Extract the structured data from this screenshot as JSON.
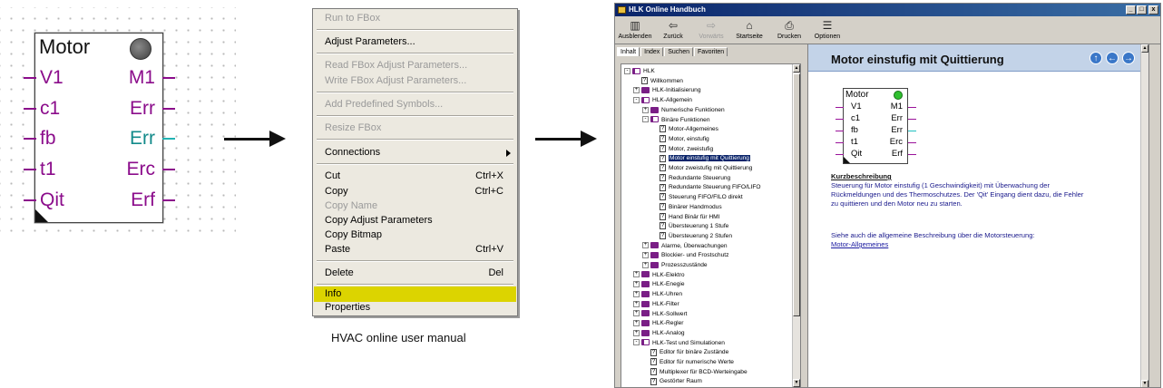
{
  "fbox": {
    "title": "Motor",
    "inputs": [
      "V1",
      "c1",
      "fb",
      "t1",
      "Qit"
    ],
    "outputs": [
      "M1",
      "Err",
      "Err",
      "Erc",
      "Erf"
    ]
  },
  "context_menu": {
    "items": [
      {
        "label": "Run to FBox",
        "enabled": false
      },
      {
        "label": "Adjust Parameters...",
        "enabled": true
      },
      {
        "label": "Read FBox Adjust Parameters...",
        "enabled": false
      },
      {
        "label": "Write FBox Adjust Parameters...",
        "enabled": false
      },
      {
        "label": "Add Predefined Symbols...",
        "enabled": false
      },
      {
        "label": "Resize FBox",
        "enabled": false
      },
      {
        "label": "Connections",
        "enabled": true,
        "submenu": true
      },
      {
        "label": "Cut",
        "shortcut": "Ctrl+X",
        "enabled": true
      },
      {
        "label": "Copy",
        "shortcut": "Ctrl+C",
        "enabled": true
      },
      {
        "label": "Copy Name",
        "enabled": false
      },
      {
        "label": "Copy Adjust Parameters",
        "enabled": true
      },
      {
        "label": "Copy Bitmap",
        "enabled": true
      },
      {
        "label": "Paste",
        "shortcut": "Ctrl+V",
        "enabled": true
      },
      {
        "label": "Delete",
        "shortcut": "Del",
        "enabled": true
      },
      {
        "label": "Info",
        "enabled": true,
        "highlighted": true
      },
      {
        "label": "Properties",
        "enabled": true
      }
    ],
    "highlight_color": "#dcd400"
  },
  "caption": "HVAC online user manual",
  "help_window": {
    "title": "HLK Online Handbuch",
    "window_buttons": [
      "_",
      "□",
      "x"
    ],
    "toolbar": [
      "Ausblenden",
      "Zurück",
      "Vorwärts",
      "Startseite",
      "Drucken",
      "Optionen"
    ],
    "tabs": [
      "Inhalt",
      "Index",
      "Suchen",
      "Favoriten"
    ],
    "tree": [
      {
        "label": "HLK",
        "level": 0,
        "kind": "book-open",
        "expander": "-"
      },
      {
        "label": "Willkommen",
        "level": 1,
        "kind": "page"
      },
      {
        "label": "HLK-Initialisierung",
        "level": 1,
        "kind": "book",
        "expander": "+"
      },
      {
        "label": "HLK-Allgemein",
        "level": 1,
        "kind": "book-open",
        "expander": "-"
      },
      {
        "label": "Numerische Funktionen",
        "level": 2,
        "kind": "book",
        "expander": "+"
      },
      {
        "label": "Binäre Funktionen",
        "level": 2,
        "kind": "book-open",
        "expander": "-"
      },
      {
        "label": "Motor-Allgemeines",
        "level": 3,
        "kind": "page"
      },
      {
        "label": "Motor, einstufig",
        "level": 3,
        "kind": "page"
      },
      {
        "label": "Motor, zweistufig",
        "level": 3,
        "kind": "page"
      },
      {
        "label": "Motor einstufig mit Quittierung",
        "level": 3,
        "kind": "page",
        "selected": true
      },
      {
        "label": "Motor zweistufig mit Quittierung",
        "level": 3,
        "kind": "page"
      },
      {
        "label": "Redundante Steuerung",
        "level": 3,
        "kind": "page"
      },
      {
        "label": "Redundante Steuerung FIFO/LIFO",
        "level": 3,
        "kind": "page"
      },
      {
        "label": "Steuerung FIFO/FILO direkt",
        "level": 3,
        "kind": "page"
      },
      {
        "label": "Binärer Handmodus",
        "level": 3,
        "kind": "page"
      },
      {
        "label": "Hand Binär für HMI",
        "level": 3,
        "kind": "page"
      },
      {
        "label": "Übersteuerung 1 Stufe",
        "level": 3,
        "kind": "page"
      },
      {
        "label": "Übersteuerung 2 Stufen",
        "level": 3,
        "kind": "page"
      },
      {
        "label": "Alarme, Überwachungen",
        "level": 2,
        "kind": "book",
        "expander": "+"
      },
      {
        "label": "Blockier- und Frostschutz",
        "level": 2,
        "kind": "book",
        "expander": "+"
      },
      {
        "label": "Prozesszustände",
        "level": 2,
        "kind": "book",
        "expander": "+"
      },
      {
        "label": "HLK-Elektro",
        "level": 1,
        "kind": "book",
        "expander": "+"
      },
      {
        "label": "HLK-Enegie",
        "level": 1,
        "kind": "book",
        "expander": "+"
      },
      {
        "label": "HLK-Uhren",
        "level": 1,
        "kind": "book",
        "expander": "+"
      },
      {
        "label": "HLK-Filter",
        "level": 1,
        "kind": "book",
        "expander": "+"
      },
      {
        "label": "HLK-Sollwert",
        "level": 1,
        "kind": "book",
        "expander": "+"
      },
      {
        "label": "HLK-Regler",
        "level": 1,
        "kind": "book",
        "expander": "+"
      },
      {
        "label": "HLK-Analog",
        "level": 1,
        "kind": "book",
        "expander": "+"
      },
      {
        "label": "HLK-Test und Simulationen",
        "level": 1,
        "kind": "book-open",
        "expander": "-"
      },
      {
        "label": "Editor für binäre Zustände",
        "level": 2,
        "kind": "page"
      },
      {
        "label": "Editor für numerische Werte",
        "level": 2,
        "kind": "page"
      },
      {
        "label": "Multiplexer für BCD-Werteingabe",
        "level": 2,
        "kind": "page"
      },
      {
        "label": "Gestörter Raum",
        "level": 2,
        "kind": "page"
      }
    ],
    "content": {
      "heading": "Motor einstufig mit Quittierung",
      "nav_buttons": [
        "up-icon",
        "back-icon",
        "forward-icon"
      ],
      "fbox": {
        "title": "Motor",
        "inputs": [
          "V1",
          "c1",
          "fb",
          "t1",
          "Qit"
        ],
        "outputs": [
          "M1",
          "Err",
          "Err",
          "Erc",
          "Erf"
        ]
      },
      "section_title": "Kurzbeschreibung",
      "description_lines": [
        "Steuerung für Motor einstufig (1 Geschwindigkeit) mit Überwachung der",
        "Rückmeldungen und des Thermoschutzes. Der 'Qit' Eingang dient dazu, die Fehler",
        "zu quittieren und den Motor neu zu starten."
      ],
      "see_also": "Siehe auch die allgemeine Beschreibung über die Motorsteuerung:",
      "see_also_link": "Motor-Allgemeines"
    }
  }
}
